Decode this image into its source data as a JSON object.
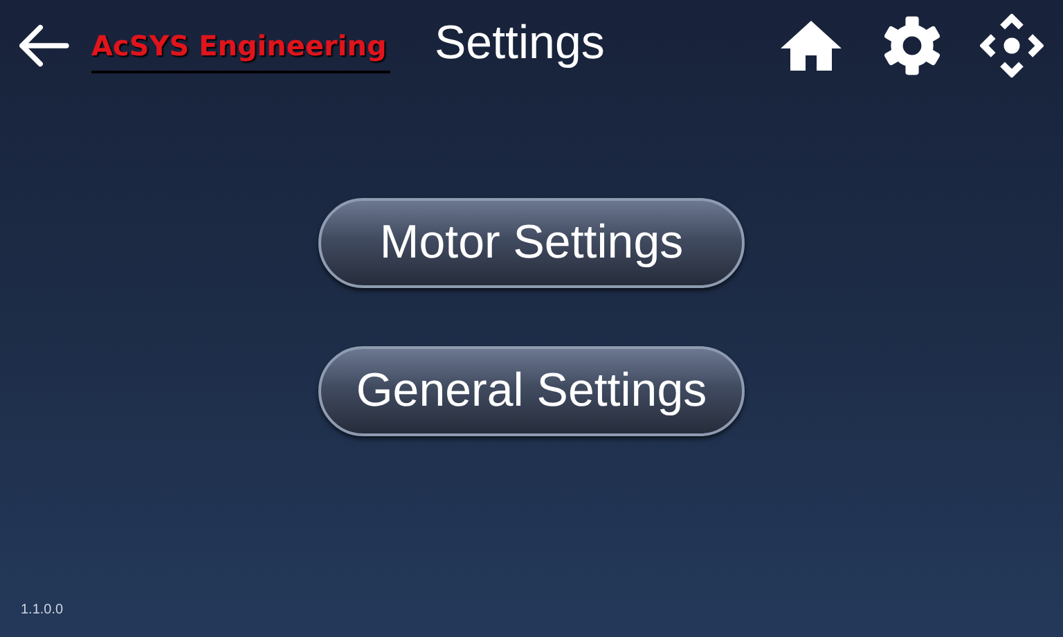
{
  "header": {
    "logo": "AcSYS Engineering",
    "title": "Settings"
  },
  "menu_buttons": [
    {
      "label": "Motor Settings"
    },
    {
      "label": "General Settings"
    }
  ],
  "version": "1.1.0.0"
}
